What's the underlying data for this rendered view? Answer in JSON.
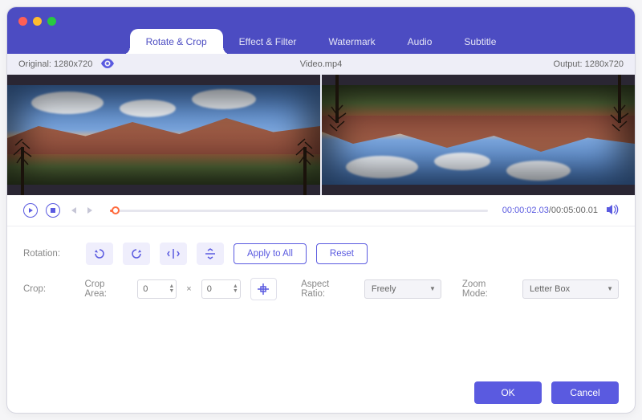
{
  "tabs": [
    "Rotate & Crop",
    "Effect & Filter",
    "Watermark",
    "Audio",
    "Subtitle"
  ],
  "active_tab": 0,
  "info": {
    "original_label": "Original: 1280x720",
    "filename": "Video.mp4",
    "output_label": "Output: 1280x720"
  },
  "playback": {
    "current": "00:00:02.03",
    "total": "/00:05:00.01"
  },
  "rotation": {
    "label": "Rotation:",
    "apply_all": "Apply to All",
    "reset": "Reset"
  },
  "crop": {
    "label": "Crop:",
    "area_label": "Crop Area:",
    "x": "0",
    "y": "0",
    "sep": "×",
    "aspect_label": "Aspect Ratio:",
    "aspect_value": "Freely",
    "zoom_label": "Zoom Mode:",
    "zoom_value": "Letter Box"
  },
  "footer": {
    "ok": "OK",
    "cancel": "Cancel"
  }
}
